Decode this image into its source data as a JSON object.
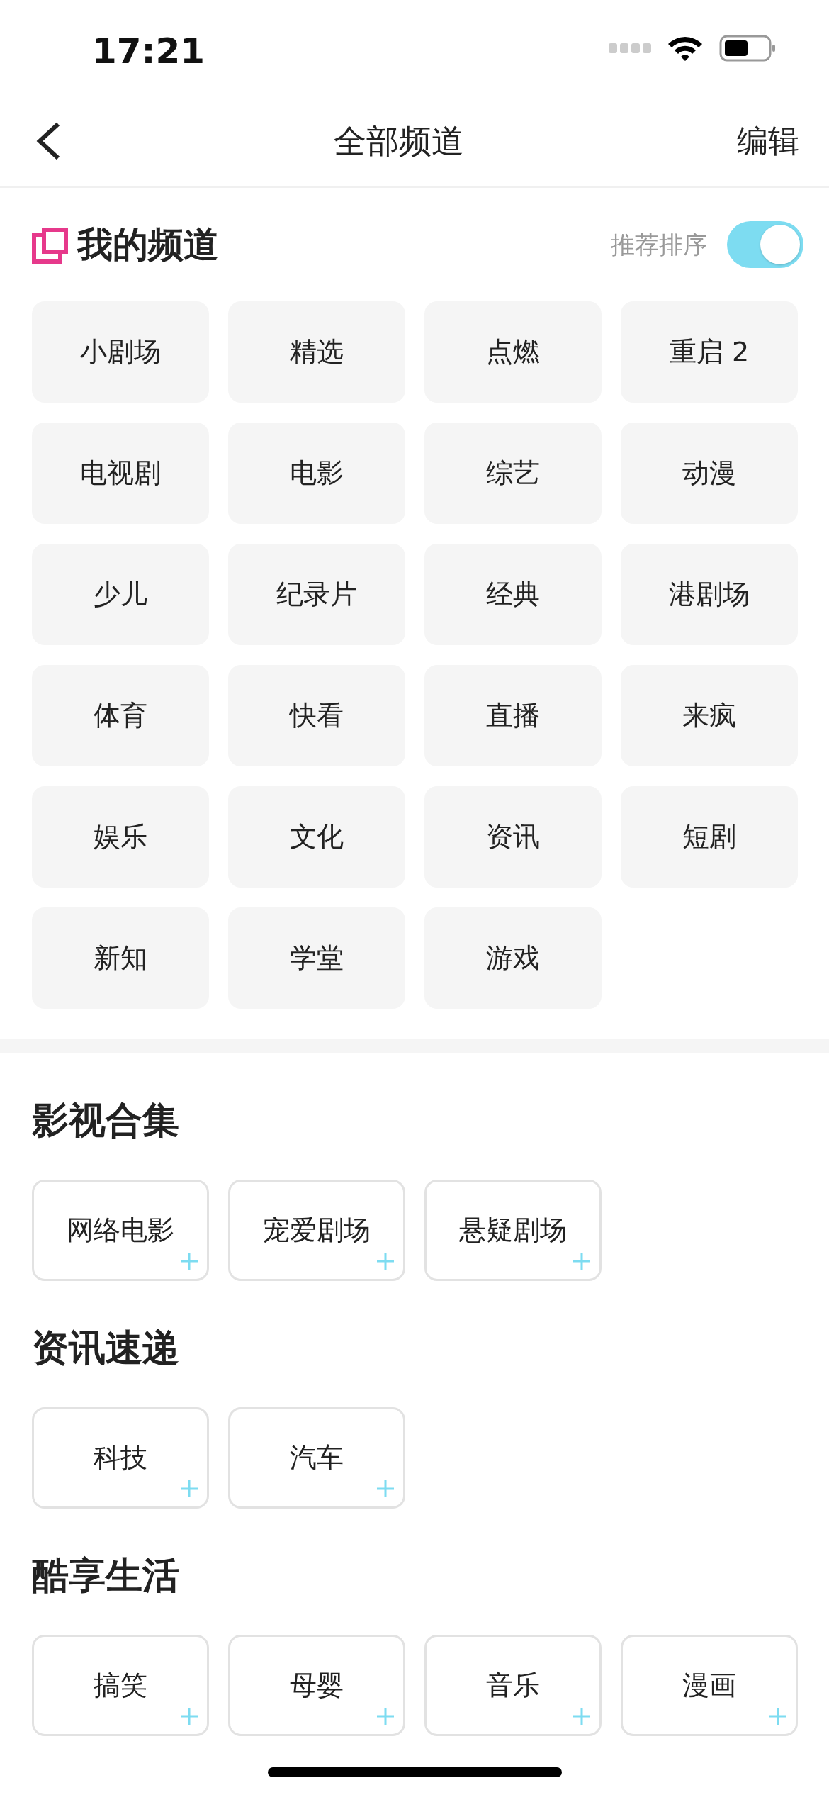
{
  "status_bar": {
    "time": "17:21"
  },
  "nav": {
    "title": "全部频道",
    "action": "编辑"
  },
  "my_channels": {
    "title": "我的频道",
    "sort_label": "推荐排序",
    "sort_toggle_on": true,
    "items": [
      "小剧场",
      "精选",
      "点燃",
      "重启 2",
      "电视剧",
      "电影",
      "综艺",
      "动漫",
      "少儿",
      "纪录片",
      "经典",
      "港剧场",
      "体育",
      "快看",
      "直播",
      "来疯",
      "娱乐",
      "文化",
      "资讯",
      "短剧",
      "新知",
      "学堂",
      "游戏"
    ]
  },
  "groups": [
    {
      "title": "影视合集",
      "items": [
        "网络电影",
        "宠爱剧场",
        "悬疑剧场"
      ]
    },
    {
      "title": "资讯速递",
      "items": [
        "科技",
        "汽车"
      ]
    },
    {
      "title": "酷享生活",
      "items": [
        "搞笑",
        "母婴",
        "音乐",
        "漫画"
      ]
    }
  ]
}
